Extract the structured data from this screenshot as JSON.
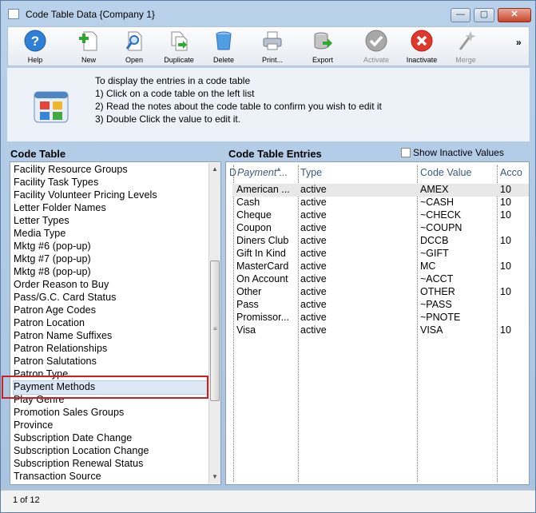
{
  "window": {
    "title": "Code Table Data {Company 1}",
    "close_glyph": "✕",
    "min_glyph": "—",
    "max_glyph": "▢"
  },
  "toolbar": {
    "buttons": [
      {
        "label": "Help",
        "icon": "help-icon",
        "enabled": true
      },
      {
        "label": "New",
        "icon": "new-icon",
        "enabled": true
      },
      {
        "label": "Open",
        "icon": "open-icon",
        "enabled": true
      },
      {
        "label": "Duplicate",
        "icon": "duplicate-icon",
        "enabled": true
      },
      {
        "label": "Delete",
        "icon": "delete-icon",
        "enabled": true
      },
      {
        "label": "Print...",
        "icon": "print-icon",
        "enabled": true
      },
      {
        "label": "Export",
        "icon": "export-icon",
        "enabled": true
      },
      {
        "label": "Activate",
        "icon": "activate-icon",
        "enabled": false
      },
      {
        "label": "Inactivate",
        "icon": "inactivate-icon",
        "enabled": true
      },
      {
        "label": "Merge",
        "icon": "merge-icon",
        "enabled": false
      }
    ],
    "more_glyph": "»"
  },
  "info": {
    "lines": [
      "To display the entries in a code table",
      "1) Click on a code table on the left list",
      "2) Read the notes about the code table to confirm you wish to edit it",
      "3) Double Click the value to edit it."
    ]
  },
  "left_panel": {
    "title": "Code Table",
    "items": [
      "Facility Resource Groups",
      "Facility Task Types",
      "Facility Volunteer Pricing Levels",
      "Letter Folder Names",
      "Letter Types",
      "Media Type",
      "Mktg #6 (pop-up)",
      "Mktg #7 (pop-up)",
      "Mktg #8 (pop-up)",
      "Order Reason to Buy",
      "Pass/G.C. Card Status",
      "Patron Age Codes",
      "Patron Location",
      "Patron Name Suffixes",
      "Patron Relationships",
      "Patron Salutations",
      "Patron Type",
      "Payment Methods",
      "Play Genre",
      "Promotion Sales Groups",
      "Province",
      "Subscription Date Change",
      "Subscription Location Change",
      "Subscription Renewal Status",
      "Transaction Source"
    ],
    "selected": "Payment Methods"
  },
  "right_panel": {
    "title": "Code Table Entries",
    "show_inactive_label": "Show Inactive Values",
    "show_inactive_checked": false,
    "columns": [
      "D",
      "Payment ...",
      "Type",
      "Code Value",
      "Acco"
    ],
    "rows": [
      {
        "payment": "American ...",
        "type": "active",
        "code": "AMEX",
        "acct": "10"
      },
      {
        "payment": "Cash",
        "type": "active",
        "code": "~CASH",
        "acct": "10"
      },
      {
        "payment": "Cheque",
        "type": "active",
        "code": "~CHECK",
        "acct": "10"
      },
      {
        "payment": "Coupon",
        "type": "active",
        "code": "~COUPN",
        "acct": ""
      },
      {
        "payment": "Diners Club",
        "type": "active",
        "code": "DCCB",
        "acct": "10"
      },
      {
        "payment": "Gift In Kind",
        "type": "active",
        "code": "~GIFT",
        "acct": ""
      },
      {
        "payment": "MasterCard",
        "type": "active",
        "code": "MC",
        "acct": "10"
      },
      {
        "payment": "On Account",
        "type": "active",
        "code": "~ACCT",
        "acct": ""
      },
      {
        "payment": "Other",
        "type": "active",
        "code": "OTHER",
        "acct": "10"
      },
      {
        "payment": "Pass",
        "type": "active",
        "code": "~PASS",
        "acct": ""
      },
      {
        "payment": "Promissor...",
        "type": "active",
        "code": "~PNOTE",
        "acct": ""
      },
      {
        "payment": "Visa",
        "type": "active",
        "code": "VISA",
        "acct": "10"
      }
    ]
  },
  "status": {
    "text": "1 of 12"
  },
  "colors": {
    "selection": "#dde8f6",
    "highlight_box": "#cc1f1f",
    "header_text": "#3a5a80"
  }
}
